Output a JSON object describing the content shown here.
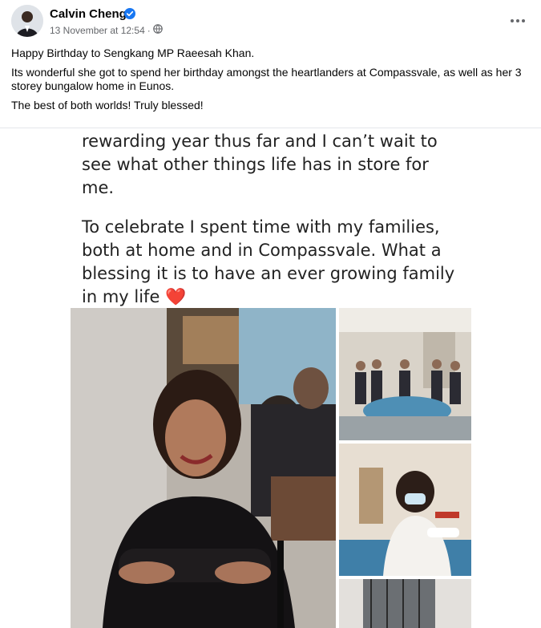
{
  "post": {
    "author": "Calvin Cheng",
    "timestamp": "13 November at 12:54",
    "separator": "·",
    "icons": {
      "verified": "verified-badge-icon",
      "privacy": "globe-icon",
      "menu": "more-options-icon"
    },
    "colors": {
      "verified": "#1877f2",
      "meta_text": "#65676b"
    },
    "caption": [
      "Happy Birthday to Sengkang MP Raeesah Khan.",
      "Its wonderful she got to spend her birthday amongst the heartlanders at Compassvale, as well as her 3 storey bungalow home in Eunos.",
      "The best of both worlds! Truly blessed!"
    ]
  },
  "shared_image": {
    "paragraphs": [
      "rewarding year thus far and I can’t wait to see what other things life has in store for me.",
      "To celebrate I spent time with my families, both at home and in Compassvale. What a blessing it is to have an ever growing family in my life"
    ],
    "emoji": "❤️",
    "photos": [
      "woman smiling with arms crossed in a cafe",
      "group of people standing around a table in a room",
      "woman wearing a mask cutting a cake"
    ]
  }
}
